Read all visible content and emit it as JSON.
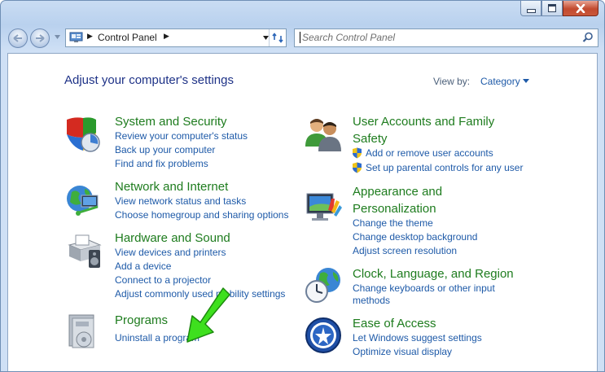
{
  "window": {
    "caption_buttons": [
      "minimize",
      "maximize",
      "close"
    ]
  },
  "address_bar": {
    "crumbs": [
      "Control Panel"
    ]
  },
  "search": {
    "placeholder": "Search Control Panel"
  },
  "main": {
    "heading": "Adjust your computer's settings",
    "view_by_label": "View by:",
    "view_by_value": "Category"
  },
  "categories": [
    {
      "title": "System and Security",
      "links": [
        "Review your computer's status",
        "Back up your computer",
        "Find and fix problems"
      ]
    },
    {
      "title": "Network and Internet",
      "links": [
        "View network status and tasks",
        "Choose homegroup and sharing options"
      ]
    },
    {
      "title": "Hardware and Sound",
      "links": [
        "View devices and printers",
        "Add a device",
        "Connect to a projector",
        "Adjust commonly used mobility settings"
      ]
    },
    {
      "title": "Programs",
      "links": [
        "Uninstall a program"
      ]
    },
    {
      "title_line1": "User Accounts and Family",
      "title_line2": "Safety",
      "links": [
        "Add or remove user accounts",
        "Set up parental controls for any user"
      ]
    },
    {
      "title_line1": "Appearance and",
      "title_line2": "Personalization",
      "links": [
        "Change the theme",
        "Change desktop background",
        "Adjust screen resolution"
      ]
    },
    {
      "title": "Clock, Language, and Region",
      "link1_line1": "Change keyboards or other input",
      "link1_line2": "methods"
    },
    {
      "title": "Ease of Access",
      "links": [
        "Let Windows suggest settings",
        "Optimize visual display"
      ]
    }
  ],
  "colors": {
    "title_green": "#1e7c1e",
    "link_blue": "#1e5aa8",
    "heading_blue": "#1e3287",
    "annotation_arrow": "#3ee01e"
  }
}
